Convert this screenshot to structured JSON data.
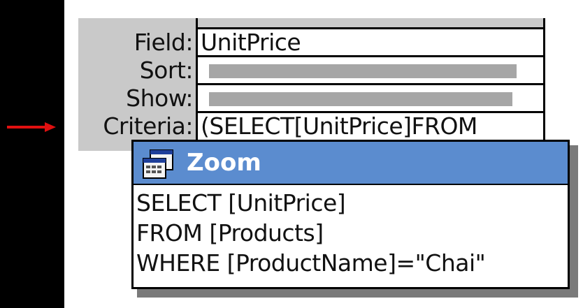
{
  "query_grid": {
    "field_label": "Field:",
    "sort_label": "Sort:",
    "show_label": "Show:",
    "criteria_label": "Criteria:",
    "field_value": "UnitPrice",
    "criteria_value": "(SELECT[UnitPrice]FROM"
  },
  "zoom_dialog": {
    "title": "Zoom",
    "lines": [
      "SELECT [UnitPrice]",
      "FROM [Products]",
      "WHERE [ProductName]=\"Chai\""
    ]
  },
  "colors": {
    "arrow": "#e01010",
    "titlebar": "#5b8ccf",
    "grid_gray": "#c9c9c9"
  }
}
